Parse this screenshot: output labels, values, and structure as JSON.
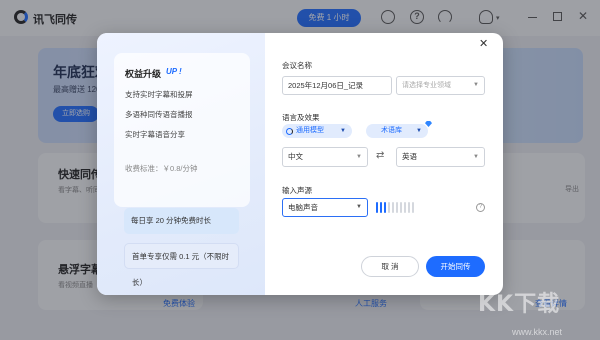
{
  "app": {
    "title": "讯飞同传",
    "free_pill": "免费 1 小时"
  },
  "background": {
    "banner_title": "年底狂欢",
    "banner_sub": "最高赠送 120",
    "banner_button": "立即选购",
    "card1_title": "快速同传",
    "card1_sub": "看字幕、听同",
    "card2_title": "悬浮字幕",
    "card2_sub": "看视频直播",
    "card3_export": "导出",
    "link_free": "免费体验",
    "link_human": "人工服务",
    "link_more": "查看详情"
  },
  "dialog": {
    "promo": {
      "title": "权益升级",
      "up": "UP !",
      "features": [
        "支持实时字幕和投屏",
        "多语种同传语音播报",
        "实时字幕语音分享"
      ],
      "price": "收费标准：￥0.8/分钟"
    },
    "plans": [
      "每日享 20 分钟免费时长",
      "首单专享仅需 0.1 元（不限时长）"
    ],
    "meeting_name_label": "会议名称",
    "meeting_name_value": "2025年12月06日_记录",
    "domain_placeholder": "请选择专业领域",
    "lang_effect_label": "语言及效果",
    "model_label": "通用模型",
    "term_label": "术语库",
    "source_lang": "中文",
    "target_lang": "英语",
    "audio_label": "输入声源",
    "audio_value": "电脑声音",
    "audio_level": 0.1,
    "cancel": "取 消",
    "start": "开始同传"
  },
  "watermark": {
    "text": "KK下载",
    "url": "www.kkx.net"
  },
  "colors": {
    "accent": "#1e6cff"
  }
}
